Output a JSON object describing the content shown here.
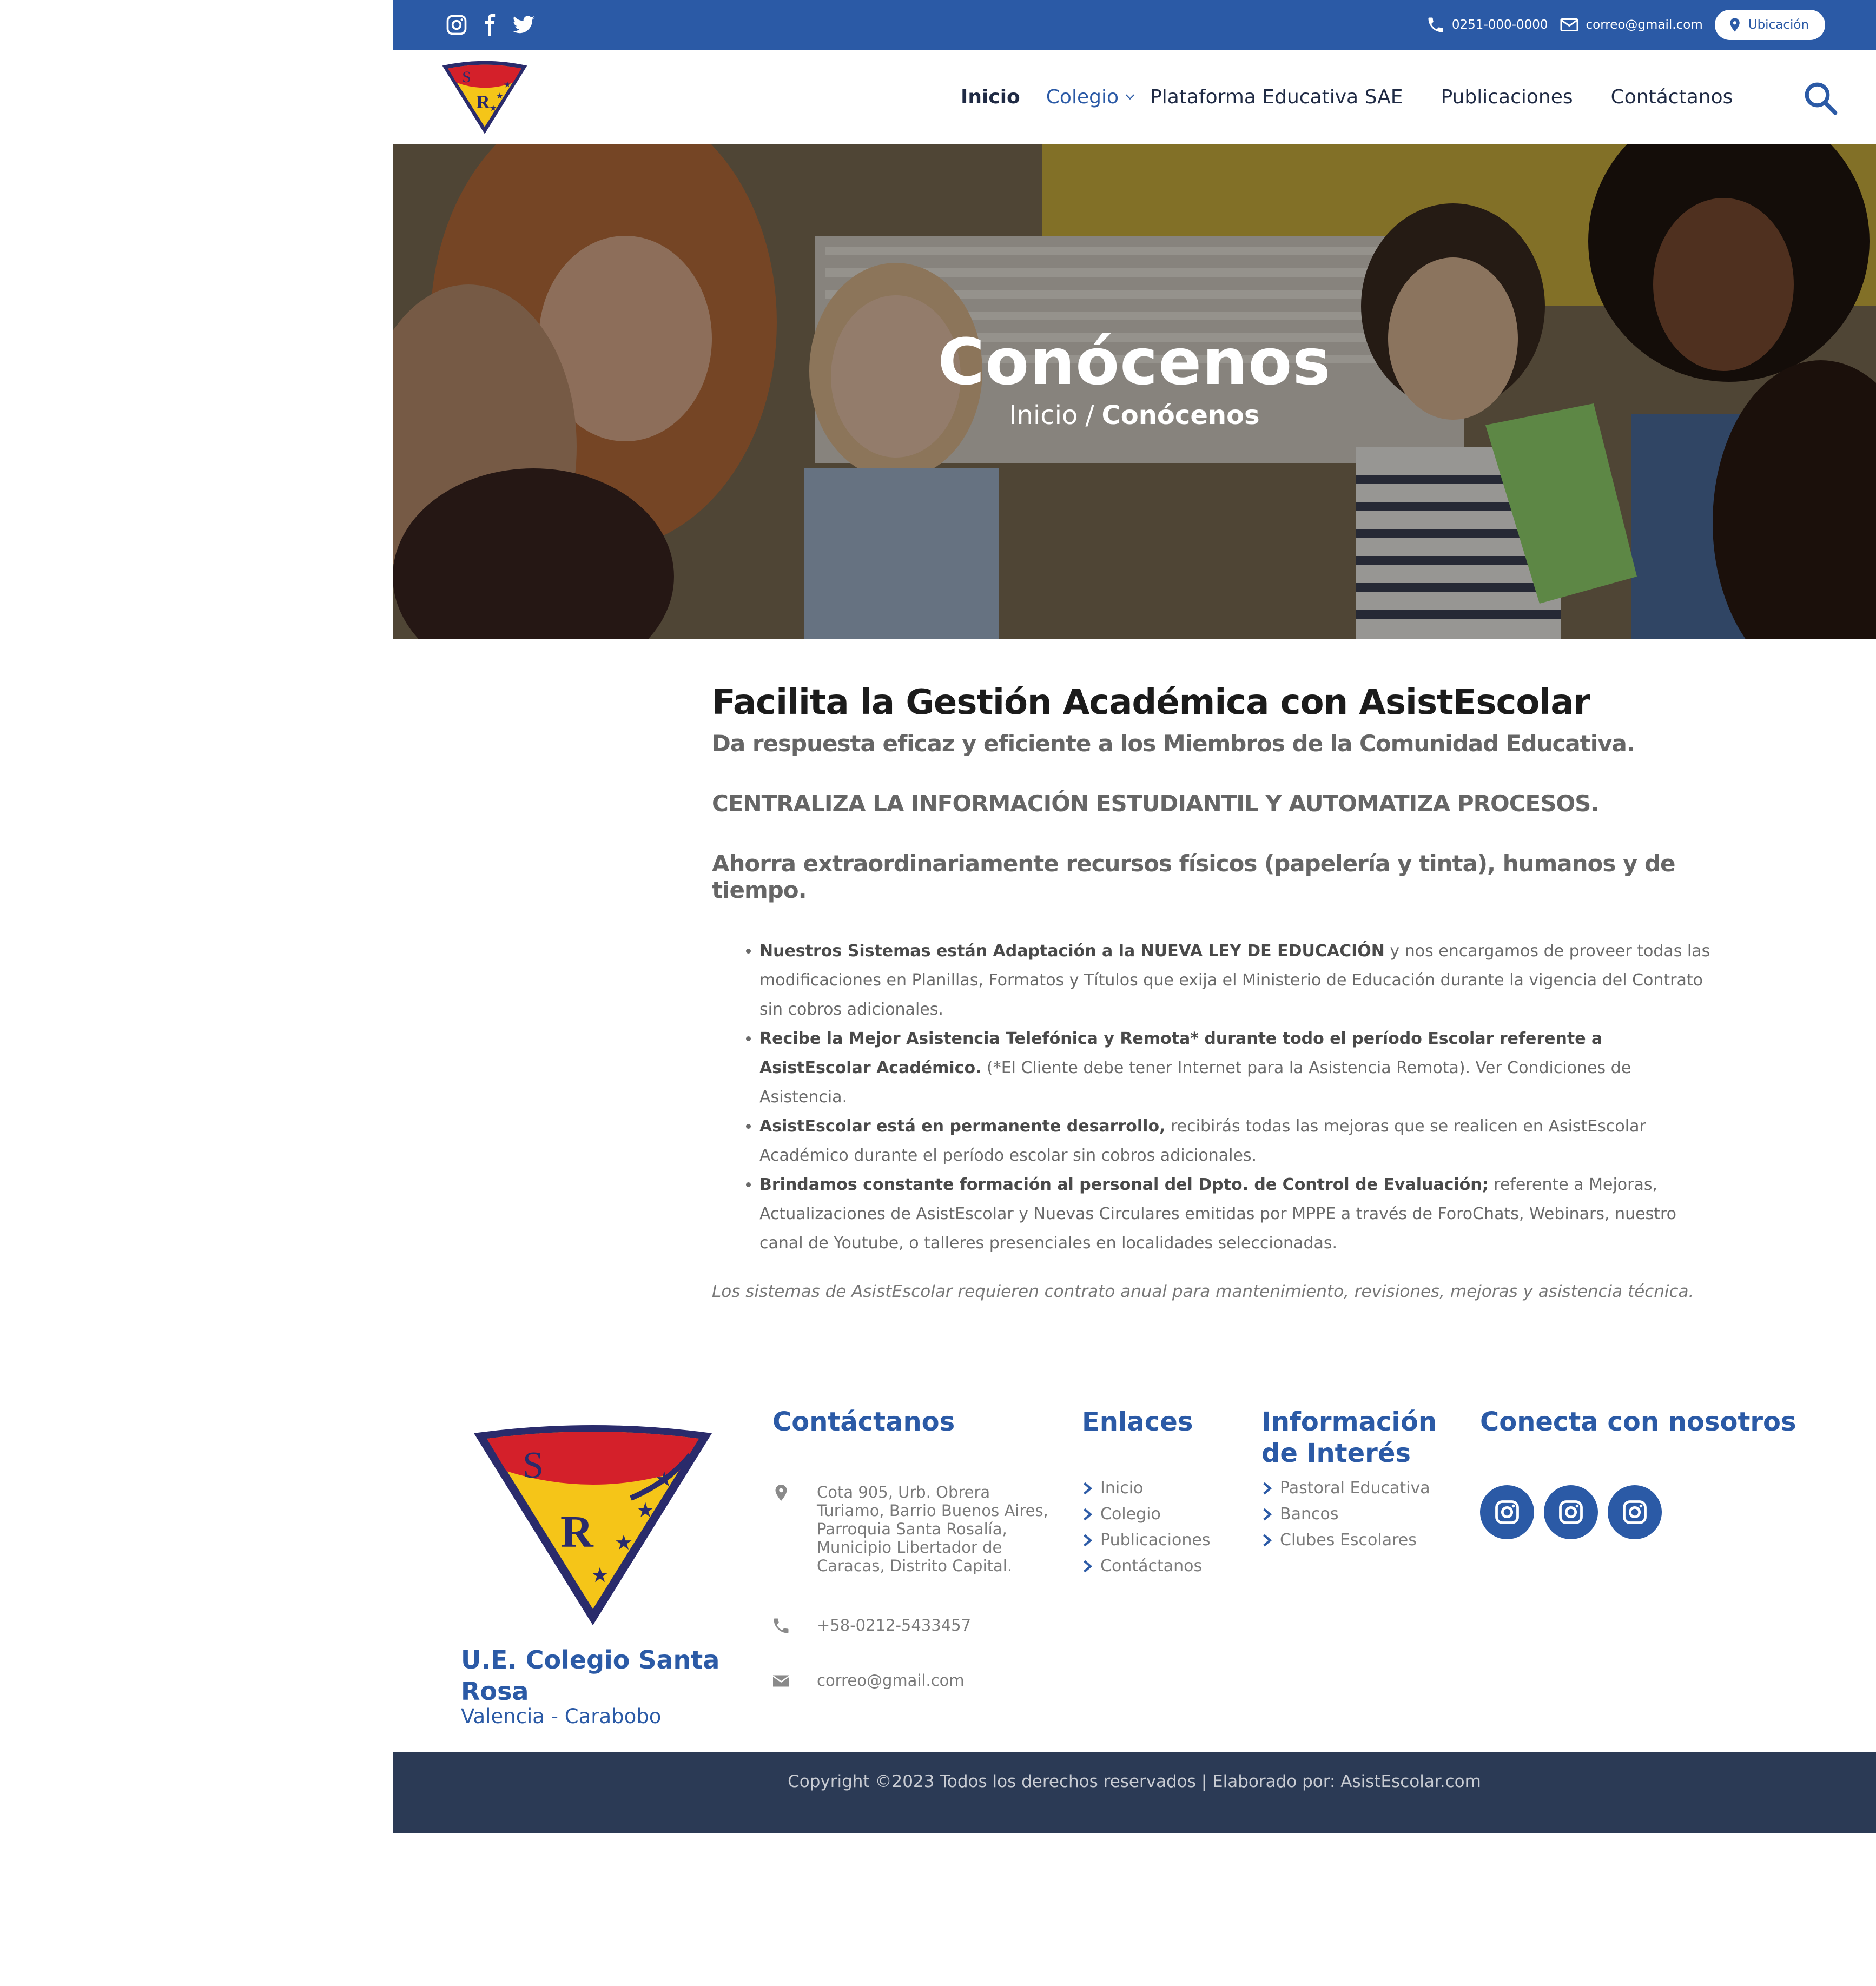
{
  "topbar": {
    "phone": "0251-000-0000",
    "email": "correo@gmail.com",
    "location_button": "Ubicación",
    "social_icons": [
      "instagram-icon",
      "facebook-icon",
      "twitter-icon"
    ]
  },
  "nav": {
    "items": [
      "Inicio",
      "Colegio",
      "Plataforma Educativa SAE",
      "Publicaciones",
      "Contáctanos"
    ]
  },
  "hero": {
    "title": "Conócenos",
    "breadcrumb_home": "Inicio",
    "breadcrumb_sep": "/",
    "breadcrumb_current": "Conócenos"
  },
  "content": {
    "heading": "Facilita la Gestión Académica con AsistEscolar",
    "subheading": "Da respuesta eficaz y eficiente a los Miembros de la Comunidad Educativa.",
    "headline_2": "CENTRALIZA LA INFORMACIÓN ESTUDIANTIL Y AUTOMATIZA PROCESOS.",
    "headline_3": "Ahorra extraordinariamente recursos físicos (papelería y tinta), humanos y de tiempo.",
    "features": [
      {
        "bold": "Nuestros Sistemas están Adaptación a la NUEVA LEY DE EDUCACIÓN",
        "text": " y nos encargamos de proveer todas las modificaciones en Planillas, Formatos y Títulos que exija el Ministerio de Educación durante la vigencia del Contrato sin cobros adicionales."
      },
      {
        "bold": "Recibe la Mejor Asistencia Telefónica y Remota* durante todo el período Escolar referente a AsistEscolar Académico.",
        "text": " (*El Cliente debe tener Internet para la Asistencia Remota). Ver Condiciones de Asistencia."
      },
      {
        "bold": "AsistEscolar está en permanente desarrollo,",
        "text": " recibirás todas las mejoras que se realicen en AsistEscolar Académico durante el período escolar sin cobros adicionales."
      },
      {
        "bold": "Brindamos constante formación al personal del Dpto. de Control de Evaluación;",
        "text": " referente a Mejoras, Actualizaciones de AsistEscolar y Nuevas Circulares emitidas por MPPE a través de ForoChats, Webinars, nuestro canal de Youtube, o talleres presenciales en localidades seleccionadas."
      }
    ],
    "note": "Los sistemas de AsistEscolar requieren contrato anual para mantenimiento, revisiones, mejoras y asistencia técnica."
  },
  "footer": {
    "school_name": "U.E. Colegio Santa Rosa",
    "city": "Valencia - Carabobo",
    "contact_heading": "Contáctanos",
    "address": "Cota 905, Urb. Obrera Turiamo, Barrio Buenos Aires, Parroquia Santa Rosalía, Municipio Libertador de Caracas, Distrito Capital.",
    "phone": "+58-0212-5433457",
    "email": "correo@gmail.com",
    "links_heading": "Enlaces",
    "links": [
      "Inicio",
      "Colegio",
      "Publicaciones",
      "Contáctanos"
    ],
    "info_heading": "Información de Interés",
    "info_links": [
      "Pastoral Educativa",
      "Bancos",
      "Clubes Escolares"
    ],
    "social_heading": "Conecta con nosotros"
  },
  "copyright": "Copyright ©2023 Todos los derechos reservados | Elaborado por:  AsistEscolar.com",
  "colors": {
    "brand_blue": "#2b5aa6",
    "footer_bar": "#2b3a55",
    "logo_red": "#d4202a",
    "logo_yellow": "#f5c518"
  }
}
